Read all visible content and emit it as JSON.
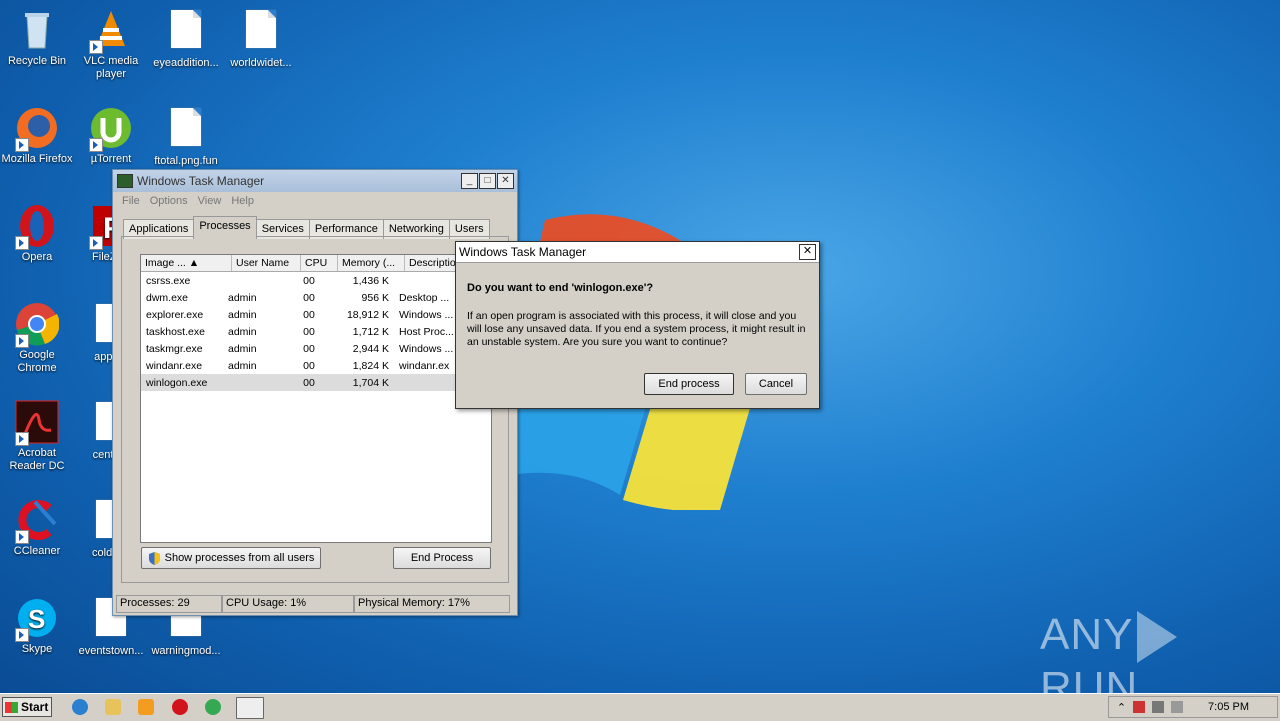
{
  "desktop": {
    "icons": [
      {
        "label": "Recycle Bin",
        "icon": "recycle-bin-icon"
      },
      {
        "label": "VLC media player",
        "icon": "vlc-icon"
      },
      {
        "label": "eyeaddition...",
        "icon": "file-icon"
      },
      {
        "label": "worldwidet...",
        "icon": "file-icon"
      },
      {
        "label": "Mozilla Firefox",
        "icon": "firefox-icon"
      },
      {
        "label": "µTorrent",
        "icon": "utorrent-icon"
      },
      {
        "label": "ftotal.png.fun",
        "icon": "file-icon"
      },
      {
        "label": "Opera",
        "icon": "opera-icon"
      },
      {
        "label": "FileZilla",
        "icon": "filezilla-icon"
      },
      {
        "label": "Google Chrome",
        "icon": "chrome-icon"
      },
      {
        "label": "approv",
        "icon": "file-icon"
      },
      {
        "label": "Acrobat Reader DC",
        "icon": "acrobat-icon"
      },
      {
        "label": "centerb",
        "icon": "file-icon"
      },
      {
        "label": "CCleaner",
        "icon": "ccleaner-icon"
      },
      {
        "label": "coldnev",
        "icon": "file-icon"
      },
      {
        "label": "Skype",
        "icon": "skype-icon"
      },
      {
        "label": "eventstown...",
        "icon": "file-icon"
      },
      {
        "label": "warningmod...",
        "icon": "file-icon"
      }
    ],
    "watermark_left": "ANY",
    "watermark_right": "RUN"
  },
  "taskmgr": {
    "title": "Windows Task Manager",
    "menu": [
      "File",
      "Options",
      "View",
      "Help"
    ],
    "tabs": [
      "Applications",
      "Processes",
      "Services",
      "Performance",
      "Networking",
      "Users"
    ],
    "active_tab": "Processes",
    "columns": [
      "Image ...",
      "User Name",
      "CPU",
      "Memory (...",
      "Description"
    ],
    "rows": [
      {
        "image": "csrss.exe",
        "user": "",
        "cpu": "00",
        "memory": "1,436 K",
        "desc": ""
      },
      {
        "image": "dwm.exe",
        "user": "admin",
        "cpu": "00",
        "memory": "956 K",
        "desc": "Desktop ..."
      },
      {
        "image": "explorer.exe",
        "user": "admin",
        "cpu": "00",
        "memory": "18,912 K",
        "desc": "Windows ..."
      },
      {
        "image": "taskhost.exe",
        "user": "admin",
        "cpu": "00",
        "memory": "1,712 K",
        "desc": "Host Proc..."
      },
      {
        "image": "taskmgr.exe",
        "user": "admin",
        "cpu": "00",
        "memory": "2,944 K",
        "desc": "Windows ..."
      },
      {
        "image": "windanr.exe",
        "user": "admin",
        "cpu": "00",
        "memory": "1,824 K",
        "desc": "windanr.ex"
      },
      {
        "image": "winlogon.exe",
        "user": "",
        "cpu": "00",
        "memory": "1,704 K",
        "desc": ""
      }
    ],
    "show_all_label": "Show processes from all users",
    "end_process_label": "End Process",
    "status": {
      "processes": "Processes: 29",
      "cpu": "CPU Usage: 1%",
      "memory": "Physical Memory: 17%"
    }
  },
  "dialog": {
    "title": "Windows Task Manager",
    "question": "Do you want to end 'winlogon.exe'?",
    "message": "If an open program is associated with this process, it will close and you will lose any unsaved data. If you end a system process, it might result in an unstable system. Are you sure you want to continue?",
    "confirm_label": "End process",
    "cancel_label": "Cancel"
  },
  "taskbar": {
    "start_label": "Start",
    "pinned": [
      "ie-icon",
      "explorer-icon",
      "media-player-icon",
      "opera-icon",
      "chrome-icon",
      "taskmgr-icon"
    ],
    "clock": "7:05 PM"
  }
}
